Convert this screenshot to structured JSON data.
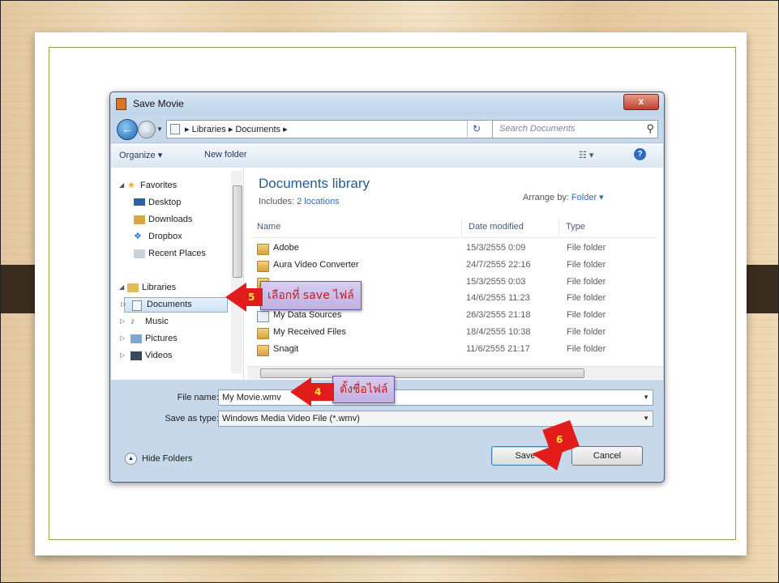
{
  "dialog": {
    "title": "Save Movie",
    "close_label": "x",
    "address": "▸ Libraries ▸ Documents ▸",
    "search_placeholder": "Search Documents"
  },
  "toolbar": {
    "organize": "Organize ▾",
    "new_folder": "New folder",
    "views": "☷ ▾",
    "help": "?"
  },
  "nav": {
    "favorites": "Favorites",
    "desktop": "Desktop",
    "downloads": "Downloads",
    "dropbox": "Dropbox",
    "recent": "Recent Places",
    "libraries": "Libraries",
    "documents": "Documents",
    "music": "Music",
    "pictures": "Pictures",
    "videos": "Videos"
  },
  "library": {
    "title": "Documents library",
    "includes_prefix": "Includes: ",
    "includes_link": "2 locations",
    "arrange_prefix": "Arrange by: ",
    "arrange_value": "Folder ▾"
  },
  "columns": {
    "name": "Name",
    "date": "Date modified",
    "type": "Type"
  },
  "files": [
    {
      "name": "Adobe",
      "date": "15/3/2555 0:09",
      "type": "File folder",
      "icon": "folder-icon"
    },
    {
      "name": "Aura Video Converter",
      "date": "24/7/2555 22:16",
      "type": "File folder",
      "icon": "folder-icon"
    },
    {
      "name": "",
      "date": "15/3/2555 0:03",
      "type": "File folder",
      "icon": "folder-icon"
    },
    {
      "name": "",
      "date": "14/6/2555 11:23",
      "type": "File folder",
      "icon": "folder-icon"
    },
    {
      "name": "My Data Sources",
      "date": "26/3/2555 21:18",
      "type": "File folder",
      "icon": "data-sources-icon"
    },
    {
      "name": "My Received Files",
      "date": "18/4/2555 10:38",
      "type": "File folder",
      "icon": "folder-icon"
    },
    {
      "name": "Snagit",
      "date": "11/6/2555 21:17",
      "type": "File folder",
      "icon": "folder-icon"
    }
  ],
  "form": {
    "file_name_label": "File name:",
    "file_name_value": "My Movie.wmv",
    "save_type_label": "Save as type:",
    "save_type_value": "Windows Media Video File (*.wmv)"
  },
  "buttons": {
    "hide_folders": "Hide Folders",
    "save": "Save",
    "cancel": "Cancel"
  },
  "annotations": {
    "step5_number": "5",
    "step5_text": "เลือกที่ save ไฟล์",
    "step4_number": "4",
    "step4_text": "ตั้งชื่อไฟล์",
    "step6_number": "6"
  },
  "colors": {
    "arrow": "#e21b1b",
    "callout_text": "#c01f1f",
    "callout_bg": "#c9bcea"
  }
}
